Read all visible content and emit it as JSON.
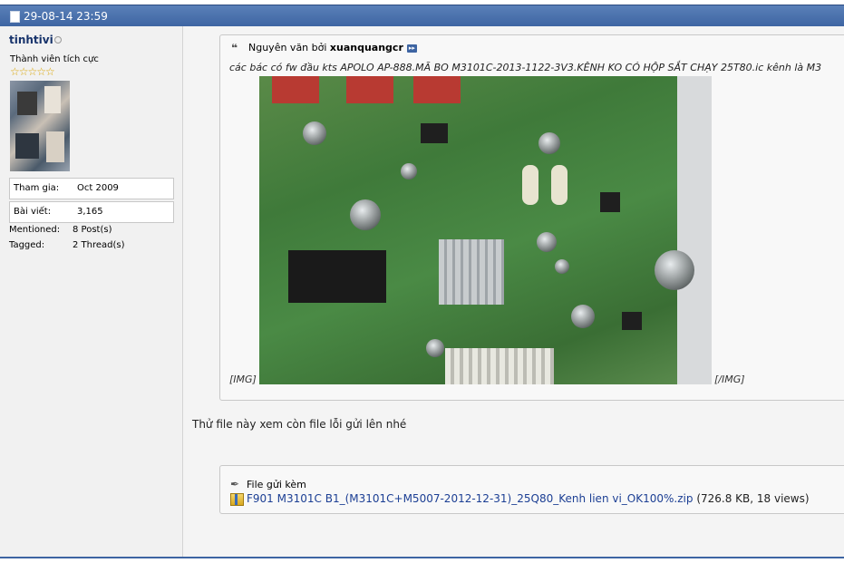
{
  "post": {
    "date": "29-08-14 23:59"
  },
  "user": {
    "name": "tinhtivi",
    "title": "Thành viên tích cực",
    "stars": "☆☆☆☆☆",
    "join_label": "Tham gia:",
    "join_value": "Oct 2009",
    "posts_label": "Bài viết:",
    "posts_value": "3,165",
    "mentioned_label": "Mentioned:",
    "mentioned_value": "8 Post(s)",
    "tagged_label": "Tagged:",
    "tagged_value": "2 Thread(s)"
  },
  "quote": {
    "prefix": "Nguyên văn bởi",
    "author": "xuanquangcr",
    "text": "các bác có fw đầu kts APOLO AP-888.MÃ BO M3101C-2013-1122-3V3.KÊNH KO CÓ HỘP SẮT CHẠY 25T80.ic kênh là M3",
    "img_open": "[IMG]",
    "img_close": "[/IMG]"
  },
  "message": {
    "text": "Thử file này xem còn file lỗi gửi lên nhé"
  },
  "attachment": {
    "title": "File gửi kèm",
    "filename": "F901 M3101C B1_(M3101C+M5007-2012-12-31)_25Q80_Kenh lien vi_OK100%.zip",
    "meta": "(726.8 KB, 18 views)"
  },
  "colors": {
    "header": "#3d64a2",
    "username": "#17336b",
    "link": "#1c3f94"
  },
  "icons": {
    "post": "post-icon",
    "online": "online-status-icon",
    "quote": "quote-icon",
    "goto": "goto-post-icon",
    "attachment": "paperclip-icon",
    "zip": "zip-file-icon"
  }
}
